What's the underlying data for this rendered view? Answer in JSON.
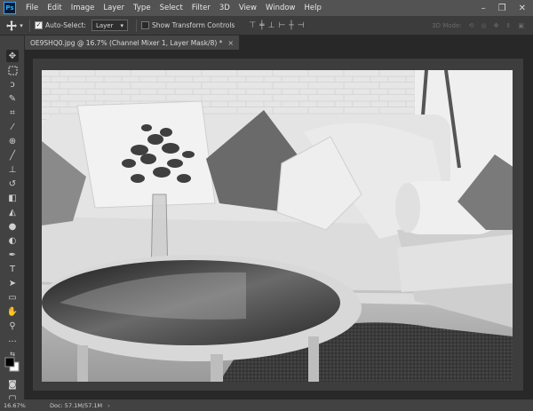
{
  "menu": {
    "logo": "Ps",
    "items": [
      "File",
      "Edit",
      "Image",
      "Layer",
      "Type",
      "Select",
      "Filter",
      "3D",
      "View",
      "Window",
      "Help"
    ],
    "window_controls": [
      "–",
      "❐",
      "✕"
    ]
  },
  "options": {
    "auto_select_label": "Auto-Select:",
    "auto_select_checked": true,
    "target_value": "Layer",
    "show_transform_label": "Show Transform Controls",
    "show_transform_checked": false,
    "mode_3d_label": "3D Mode:"
  },
  "document": {
    "tab_title": "OE9SHQ0.jpg @ 16.7% (Channel Mixer 1, Layer Mask/8) *",
    "close_glyph": "×"
  },
  "status": {
    "zoom": "16.67%",
    "doc_size": "Doc: 57.1M/57.1M"
  },
  "colors": {
    "menubar_bg": "#535353",
    "options_bg": "#3c3c3c",
    "toolbar_bg": "#424242",
    "workspace_bg": "#282828",
    "ps_accent": "#31a8ff"
  },
  "tools": [
    "move-tool-icon",
    "marquee-tool-icon",
    "lasso-tool-icon",
    "quick-select-tool-icon",
    "crop-tool-icon",
    "eyedropper-tool-icon",
    "healing-brush-tool-icon",
    "brush-tool-icon",
    "clone-stamp-tool-icon",
    "history-brush-tool-icon",
    "eraser-tool-icon",
    "gradient-tool-icon",
    "blur-tool-icon",
    "dodge-tool-icon",
    "pen-tool-icon",
    "type-tool-icon",
    "path-selection-tool-icon",
    "rectangle-tool-icon",
    "hand-tool-icon",
    "zoom-tool-icon",
    "more-tools-icon",
    "default-colors-icon",
    "color-swatches-icon",
    "quick-mask-icon",
    "screen-mode-icon"
  ]
}
